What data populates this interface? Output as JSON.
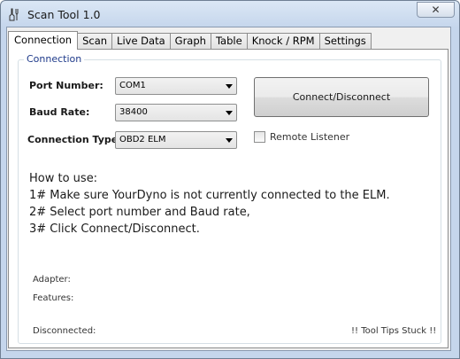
{
  "window": {
    "title": "Scan Tool 1.0",
    "close_glyph": "✕"
  },
  "tabs": [
    {
      "label": "Connection",
      "active": true
    },
    {
      "label": "Scan"
    },
    {
      "label": "Live Data"
    },
    {
      "label": "Graph"
    },
    {
      "label": "Table"
    },
    {
      "label": "Knock / RPM"
    },
    {
      "label": "Settings"
    }
  ],
  "connection": {
    "group_title": "Connection",
    "port_label": "Port Number:",
    "port_value": "COM1",
    "baud_label": "Baud Rate:",
    "baud_value": "38400",
    "type_label": "Connection Type:",
    "type_value": "OBD2 ELM",
    "connect_button": "Connect/Disconnect",
    "remote_listener_label": "Remote Listener",
    "remote_listener_checked": false
  },
  "howto": {
    "title": "How to use:",
    "steps": [
      "1# Make sure YourDyno is not currently connected to the ELM.",
      "2# Select port number and Baud rate,",
      "3# Click Connect/Disconnect."
    ]
  },
  "info": {
    "adapter_label": "Adapter:",
    "features_label": "Features:",
    "status": "Disconnected:",
    "tooltip_notice": "!! Tool Tips Stuck !!"
  }
}
